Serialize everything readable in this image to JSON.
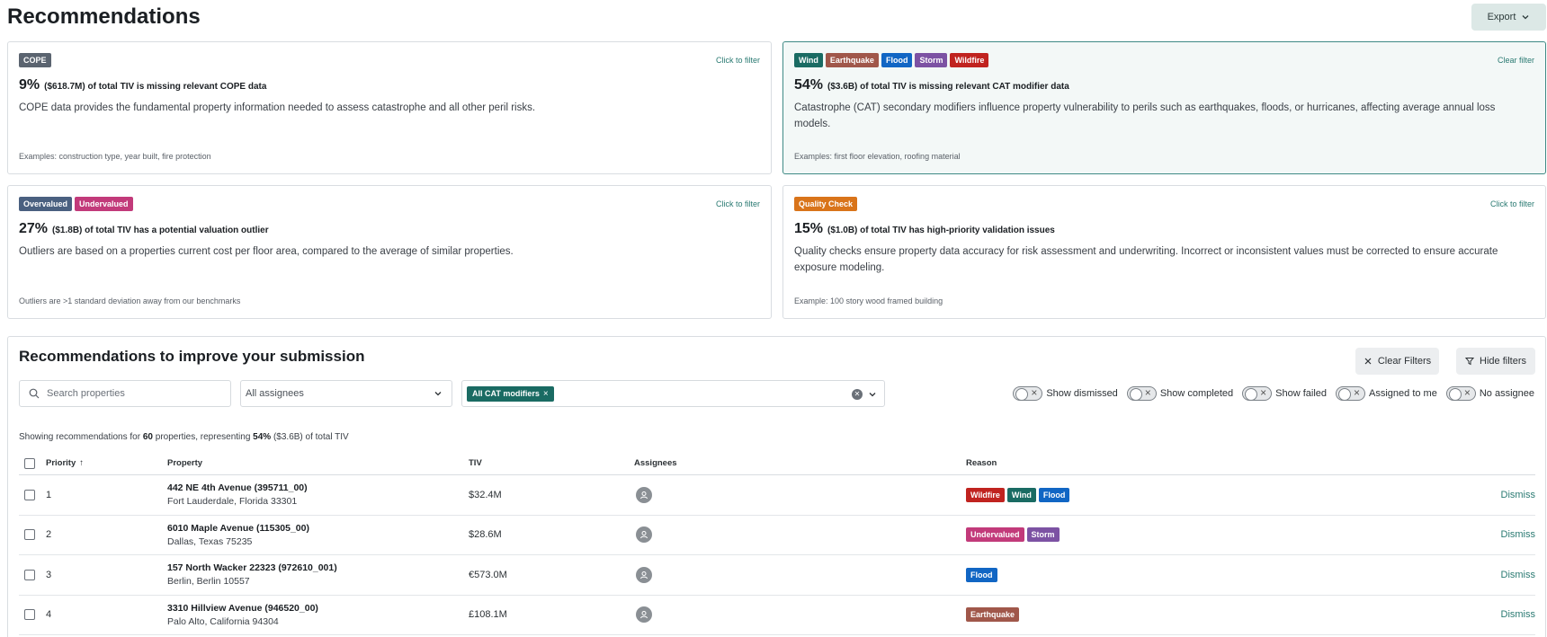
{
  "page": {
    "title": "Recommendations",
    "export_label": "Export"
  },
  "colors": {
    "wind": "#1a6b63",
    "earthquake": "#a0574a",
    "flood": "#1166c4",
    "storm": "#7c52a3",
    "wildfire": "#c0231f",
    "cope": "#5b6470",
    "overvalued": "#4a6080",
    "undervalued": "#c23a7a",
    "quality_check": "#d9741a"
  },
  "cards": [
    {
      "tags": [
        "COPE"
      ],
      "filter_label": "Click to filter",
      "pct": "9%",
      "headline": "($618.7M) of total TIV is missing relevant COPE data",
      "description": "COPE data provides the fundamental property information needed to assess catastrophe and all other peril risks.",
      "example": "Examples: construction type, year built, fire protection"
    },
    {
      "tags": [
        "Wind",
        "Earthquake",
        "Flood",
        "Storm",
        "Wildfire"
      ],
      "filter_label": "Clear filter",
      "pct": "54%",
      "headline": "($3.6B) of total TIV is missing relevant CAT modifier data",
      "description": "Catastrophe (CAT) secondary modifiers influence property vulnerability to perils such as earthquakes, floods, or hurricanes, affecting average annual loss models.",
      "example": "Examples: first floor elevation, roofing material"
    },
    {
      "tags": [
        "Overvalued",
        "Undervalued"
      ],
      "filter_label": "Click to filter",
      "pct": "27%",
      "headline": "($1.8B) of total TIV has a potential valuation outlier",
      "description": "Outliers are based on a properties current cost per floor area, compared to the average of similar properties.",
      "example": "Outliers are >1 standard deviation away from our benchmarks"
    },
    {
      "tags": [
        "Quality Check"
      ],
      "filter_label": "Click to filter",
      "pct": "15%",
      "headline": "($1.0B) of total TIV has high-priority validation issues",
      "description": "Quality checks ensure property data accuracy for risk assessment and underwriting. Incorrect or inconsistent values must be corrected to ensure accurate exposure modeling.",
      "example": "Example: 100 story wood framed building"
    }
  ],
  "section": {
    "title": "Recommendations to improve your submission",
    "clear_filters": "Clear Filters",
    "hide_filters": "Hide filters",
    "search_placeholder": "Search properties",
    "assignee_select": "All assignees",
    "active_chip": "All CAT modifiers",
    "toggles": [
      "Show dismissed",
      "Show completed",
      "Show failed",
      "Assigned to me",
      "No assignee"
    ],
    "summary": {
      "prefix": "Showing recommendations for",
      "count": "60",
      "middle": "properties, representing",
      "pct": "54%",
      "suffix": "($3.6B) of total TIV"
    }
  },
  "table": {
    "headers": {
      "priority": "Priority",
      "property": "Property",
      "tiv": "TIV",
      "assignees": "Assignees",
      "reason": "Reason"
    },
    "rows": [
      {
        "priority": "1",
        "name": "442 NE 4th Avenue (395711_00)",
        "address": "Fort Lauderdale, Florida 33301",
        "tiv": "$32.4M",
        "reasons": [
          "Wildfire",
          "Wind",
          "Flood"
        ],
        "action": "Dismiss"
      },
      {
        "priority": "2",
        "name": "6010 Maple Avenue (115305_00)",
        "address": "Dallas, Texas 75235",
        "tiv": "$28.6M",
        "reasons": [
          "Undervalued",
          "Storm"
        ],
        "action": "Dismiss"
      },
      {
        "priority": "3",
        "name": "157 North Wacker 22323 (972610_001)",
        "address": "Berlin, Berlin 10557",
        "tiv": "€573.0M",
        "reasons": [
          "Flood"
        ],
        "action": "Dismiss"
      },
      {
        "priority": "4",
        "name": "3310 Hillview Avenue (946520_00)",
        "address": "Palo Alto, California 94304",
        "tiv": "£108.1M",
        "reasons": [
          "Earthquake"
        ],
        "action": "Dismiss"
      }
    ]
  }
}
